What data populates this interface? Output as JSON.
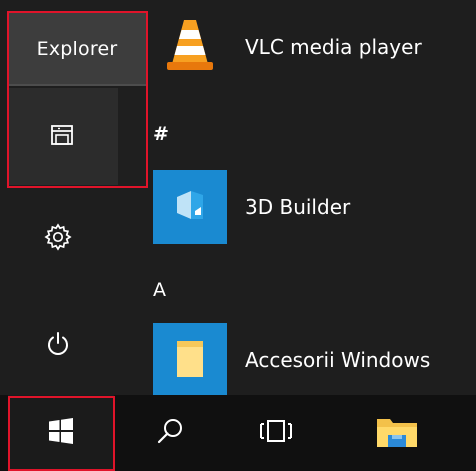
{
  "tooltip": {
    "label": "Explorer"
  },
  "rail": {
    "explorer_icon": "file-explorer-icon",
    "settings_icon": "gear-icon",
    "power_icon": "power-icon"
  },
  "apps": {
    "vlc": {
      "label": "VLC media player",
      "icon": "vlc-cone-icon",
      "tile_color": "#1e1e1e",
      "accent": "#f08a00"
    },
    "group_hash": "#",
    "builder": {
      "label": "3D Builder",
      "icon": "3d-builder-icon",
      "tile_color": "#1a8ad1"
    },
    "group_a": "A",
    "accessories": {
      "label": "Accesorii Windows",
      "icon": "folder-icon",
      "tile_color": "#1a8ad1"
    }
  },
  "taskbar": {
    "start_icon": "windows-logo-icon",
    "search_icon": "search-icon",
    "task_view_icon": "task-view-icon",
    "explorer_icon": "folder-icon"
  },
  "colors": {
    "highlight": "#e0142a",
    "menu_bg": "#1e1e1e",
    "taskbar_bg": "#101010",
    "accent": "#1a8ad1"
  }
}
